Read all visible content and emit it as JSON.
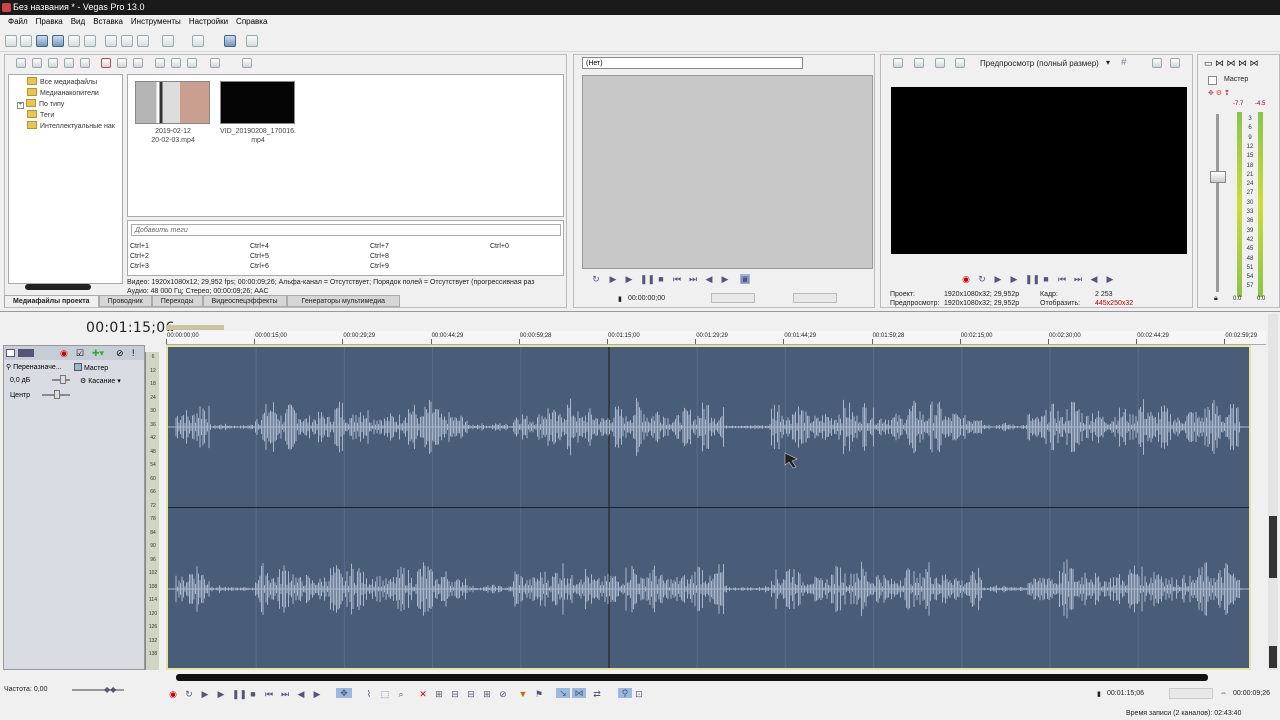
{
  "window": {
    "title": "Без названия * - Vegas Pro 13.0"
  },
  "menu": [
    "Файл",
    "Правка",
    "Вид",
    "Вставка",
    "Инструменты",
    "Настройки",
    "Справка"
  ],
  "explorer": {
    "tree": [
      "Все медиафайлы",
      "Медианакопители",
      "По типу",
      "Теги",
      "Интеллектуальные нак"
    ],
    "media": [
      {
        "caption1": "2019-02-12",
        "caption2": "20-02-03.mp4"
      },
      {
        "caption1": "VID_20190208_170016.",
        "caption2": "mp4"
      }
    ],
    "tag_placeholder": "Добавить теги",
    "shortcuts": [
      "Ctrl+1",
      "Ctrl+2",
      "Ctrl+3",
      "Ctrl+4",
      "Ctrl+5",
      "Ctrl+6",
      "Ctrl+7",
      "Ctrl+8",
      "Ctrl+9",
      "Ctrl+0"
    ],
    "info_video": "Видео: 1920x1080x12; 29,952 fps; 00:00:09;26; Альфа-канал = Отсутствует; Порядок полей = Отсутствует (прогрессивная раз",
    "info_audio": "Аудио: 48 000 Гц; Стерео; 00:00:09;26; AAC",
    "tabs": [
      "Медиафайлы проекта",
      "Проводник",
      "Переходы",
      "Видеоспецэффекты",
      "Генераторы мультимедиа"
    ]
  },
  "trimmer": {
    "select_value": "(Нет)",
    "timecode": "00:00:00;00"
  },
  "preview": {
    "mode": "Предпросмотр (полный размер)",
    "project_label": "Проект:",
    "project_value": "1920x1080x32; 29,952p",
    "preview_label": "Предпросмотр:",
    "preview_value": "1920x1080x32; 29,952p",
    "frame_label": "Кадр:",
    "frame_value": "2 253",
    "display_label": "Отобразить:",
    "display_value": "445x250x32"
  },
  "master": {
    "title": "Мастер",
    "peak_left": "-7.7",
    "peak_right": "-4.5",
    "scale": [
      "3",
      "6",
      "9",
      "12",
      "15",
      "18",
      "21",
      "24",
      "27",
      "30",
      "33",
      "36",
      "39",
      "42",
      "45",
      "48",
      "51",
      "54",
      "57"
    ],
    "val_left": "0.0",
    "val_right": "0.0"
  },
  "timeline": {
    "cursor_time": "00:01:15;06",
    "ruler": [
      "00:00:00;00",
      "00:00:15;00",
      "00:00:29;29",
      "00:00:44;29",
      "00:00:59;28",
      "00:01:15;00",
      "00:01:29;29",
      "00:01:44;29",
      "00:01:59;28",
      "00:02:15;00",
      "00:02:30;00",
      "00:02:44;29",
      "00:02:59;29"
    ],
    "track": {
      "name": "Переназначе...",
      "bus": "Мастер",
      "volume": "0,0 дБ",
      "mode": "Касание",
      "pan": "Центр"
    },
    "vu_scale": [
      "6",
      "12",
      "18",
      "24",
      "30",
      "36",
      "42",
      "48",
      "54",
      "60",
      "66",
      "72",
      "78",
      "84",
      "90",
      "96",
      "102",
      "108",
      "114",
      "120",
      "126",
      "132",
      "138"
    ],
    "rate": "Частота: 0,00",
    "time_pos": "00:01:15;06",
    "time_len": "00:00:09;26",
    "record_status": "Время записи (2 каналов): 02:43:40"
  },
  "colors": {
    "track_bg": "#4a5d78",
    "waveform": "#a9b7cc",
    "track_border": "#e4e6a0"
  }
}
